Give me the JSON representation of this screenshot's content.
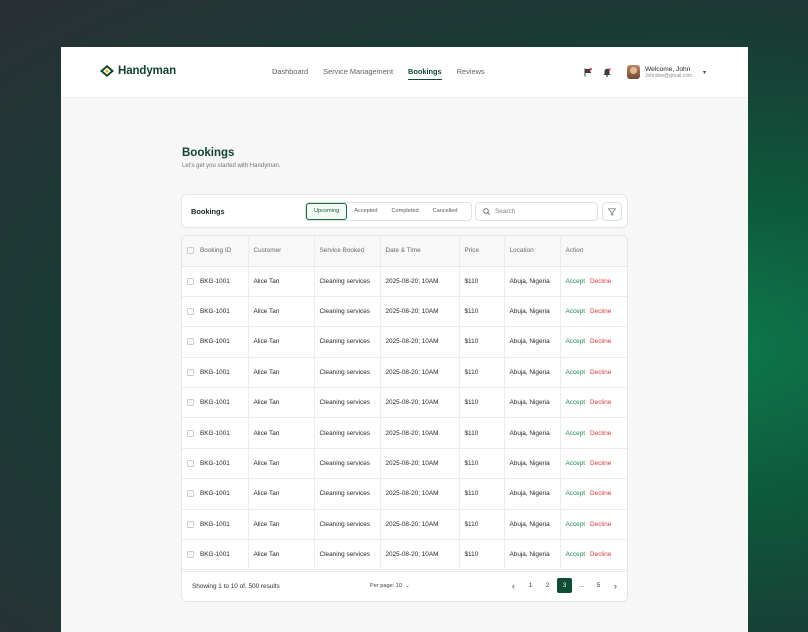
{
  "brand": {
    "name": "Handyman"
  },
  "nav": [
    {
      "label": "Dashboard",
      "active": false
    },
    {
      "label": "Service Management",
      "active": false
    },
    {
      "label": "Bookings",
      "active": true
    },
    {
      "label": "Reviews",
      "active": false
    }
  ],
  "user": {
    "greeting": "Welcome, John",
    "email": "Johndoe@gmail.com"
  },
  "page": {
    "title": "Bookings",
    "subtitle": "Let's get you started with Handyman."
  },
  "toolbar": {
    "title": "Bookings",
    "tabs": [
      "Upcoming",
      "Accepted",
      "Completed",
      "Cancelled"
    ],
    "active_tab": "Upcoming",
    "search_placeholder": "Search"
  },
  "table": {
    "columns": [
      "Booking ID",
      "Customer",
      "Service Booked",
      "Date & Time",
      "Price",
      "Location",
      "Action"
    ],
    "accept_label": "Accept",
    "decline_label": "Decline",
    "rows": [
      [
        "BKG-1001",
        "Alice Tan",
        "Cleaning services",
        "2025-08-20; 10AM",
        "$110",
        "Abuja, Nigeria"
      ],
      [
        "BKG-1001",
        "Alice Tan",
        "Cleaning services",
        "2025-08-20; 10AM",
        "$110",
        "Abuja, Nigeria"
      ],
      [
        "BKG-1001",
        "Alice Tan",
        "Cleaning services",
        "2025-08-20; 10AM",
        "$110",
        "Abuja, Nigeria"
      ],
      [
        "BKG-1001",
        "Alice Tan",
        "Cleaning services",
        "2025-08-20; 10AM",
        "$110",
        "Abuja, Nigeria"
      ],
      [
        "BKG-1001",
        "Alice Tan",
        "Cleaning services",
        "2025-08-20; 10AM",
        "$110",
        "Abuja, Nigeria"
      ],
      [
        "BKG-1001",
        "Alice Tan",
        "Cleaning services",
        "2025-08-20; 10AM",
        "$110",
        "Abuja, Nigeria"
      ],
      [
        "BKG-1001",
        "Alice Tan",
        "Cleaning services",
        "2025-08-20; 10AM",
        "$110",
        "Abuja, Nigeria"
      ],
      [
        "BKG-1001",
        "Alice Tan",
        "Cleaning services",
        "2025-08-20; 10AM",
        "$110",
        "Abuja, Nigeria"
      ],
      [
        "BKG-1001",
        "Alice Tan",
        "Cleaning services",
        "2025-08-20; 10AM",
        "$110",
        "Abuja, Nigeria"
      ],
      [
        "BKG-1001",
        "Alice Tan",
        "Cleaning services",
        "2025-08-20; 10AM",
        "$110",
        "Abuja, Nigeria"
      ]
    ]
  },
  "footer": {
    "showing": "Showing 1 to 10 of, 500 results",
    "per_page": "Per page: 10",
    "pages": [
      "1",
      "2",
      "3",
      "...",
      "5"
    ],
    "current_page": "3"
  },
  "colors": {
    "brand": "#12432e",
    "accent": "#0f4d34",
    "accept": "#1e8a4e",
    "decline": "#d83a3a"
  },
  "icons": [
    "logo-icon",
    "flag-icon",
    "bell-icon",
    "chevron-down-icon",
    "search-icon",
    "filter-icon",
    "chevron-left-icon",
    "chevron-right-icon"
  ]
}
